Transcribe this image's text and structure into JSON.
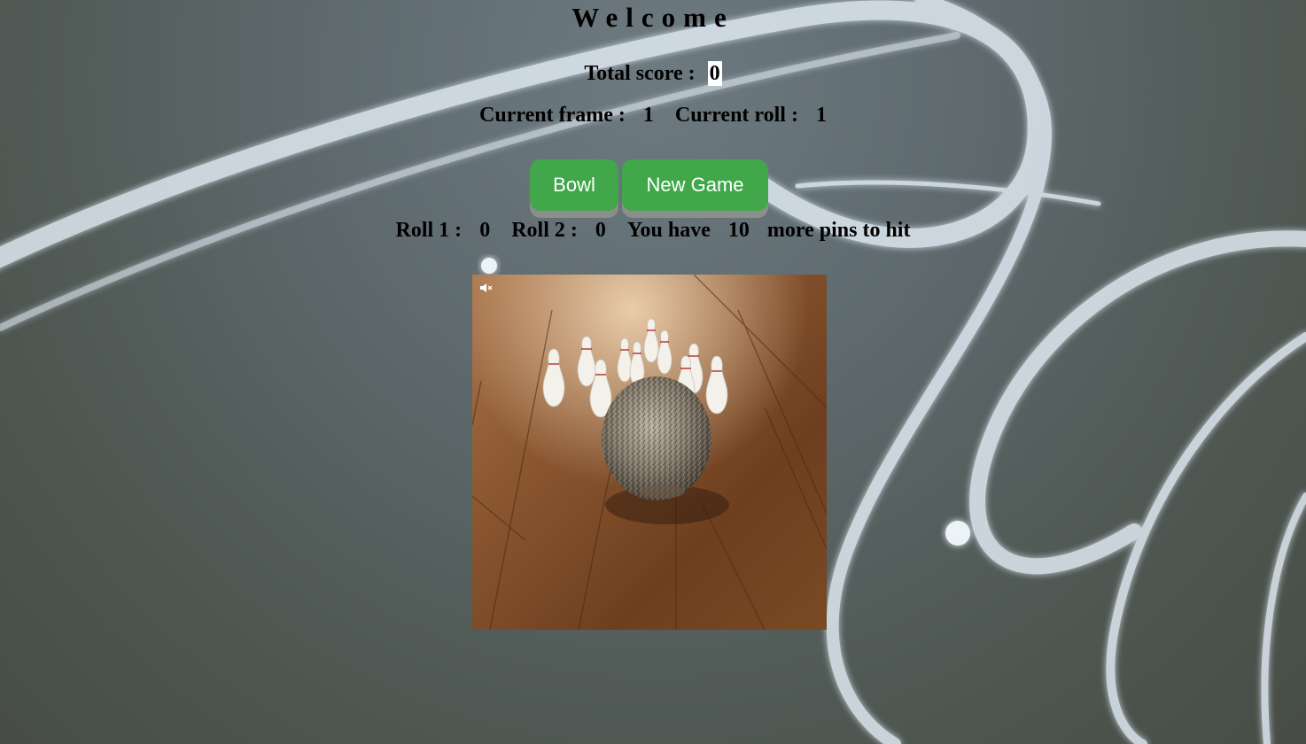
{
  "header": {
    "title": "Welcome"
  },
  "score": {
    "label": "Total score :",
    "value": "0"
  },
  "status": {
    "frame_label": "Current frame :",
    "frame_value": "1",
    "roll_label": "Current roll :",
    "roll_value": "1"
  },
  "buttons": {
    "bowl_label": "Bowl",
    "new_game_label": "New Game"
  },
  "rolls": {
    "roll1_label": "Roll 1 :",
    "roll1_value": "0",
    "roll2_label": "Roll 2 :",
    "roll2_value": "0",
    "pins_prefix": "You have",
    "pins_value": "10",
    "pins_suffix": "more pins to hit"
  },
  "media": {
    "mute_icon": "mute-icon",
    "image": "hedgehog-bowling-gif"
  },
  "colors": {
    "button": "#41a74a",
    "button_text": "#ffffff",
    "score_box": "#ffffff"
  }
}
